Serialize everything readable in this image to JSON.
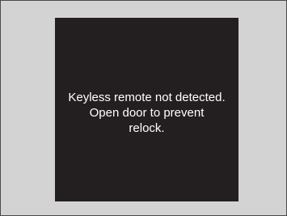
{
  "display": {
    "message_lines": [
      "Keyless remote not detected.",
      "Open door to prevent",
      "relock."
    ]
  }
}
